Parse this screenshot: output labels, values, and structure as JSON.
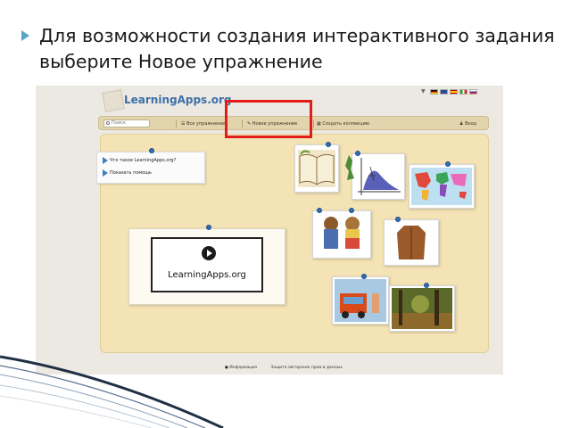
{
  "slide": {
    "bullet_text": "Для возможности создания интерактивного задания выберите Новое упражнение"
  },
  "app": {
    "logo_text": "LearningApps.org"
  },
  "menu": {
    "search_placeholder": "Поиск",
    "all_exercises": "Все упражнения",
    "new_exercise": "Новое упражнение",
    "create_collection": "Создать коллекцию",
    "login": "Вход"
  },
  "help": {
    "what_is": "Что такое LearningApps.org?",
    "show_help": "Показать помощь"
  },
  "video": {
    "label": "LearningApps.org"
  },
  "footer": {
    "info": "Информация",
    "terms": "Защита авторских прав и данных"
  },
  "colors": {
    "highlight": "#e21b1b",
    "board": "#f4e3b5",
    "menubar": "#e2d5ad",
    "accent": "#3d6fa8"
  }
}
